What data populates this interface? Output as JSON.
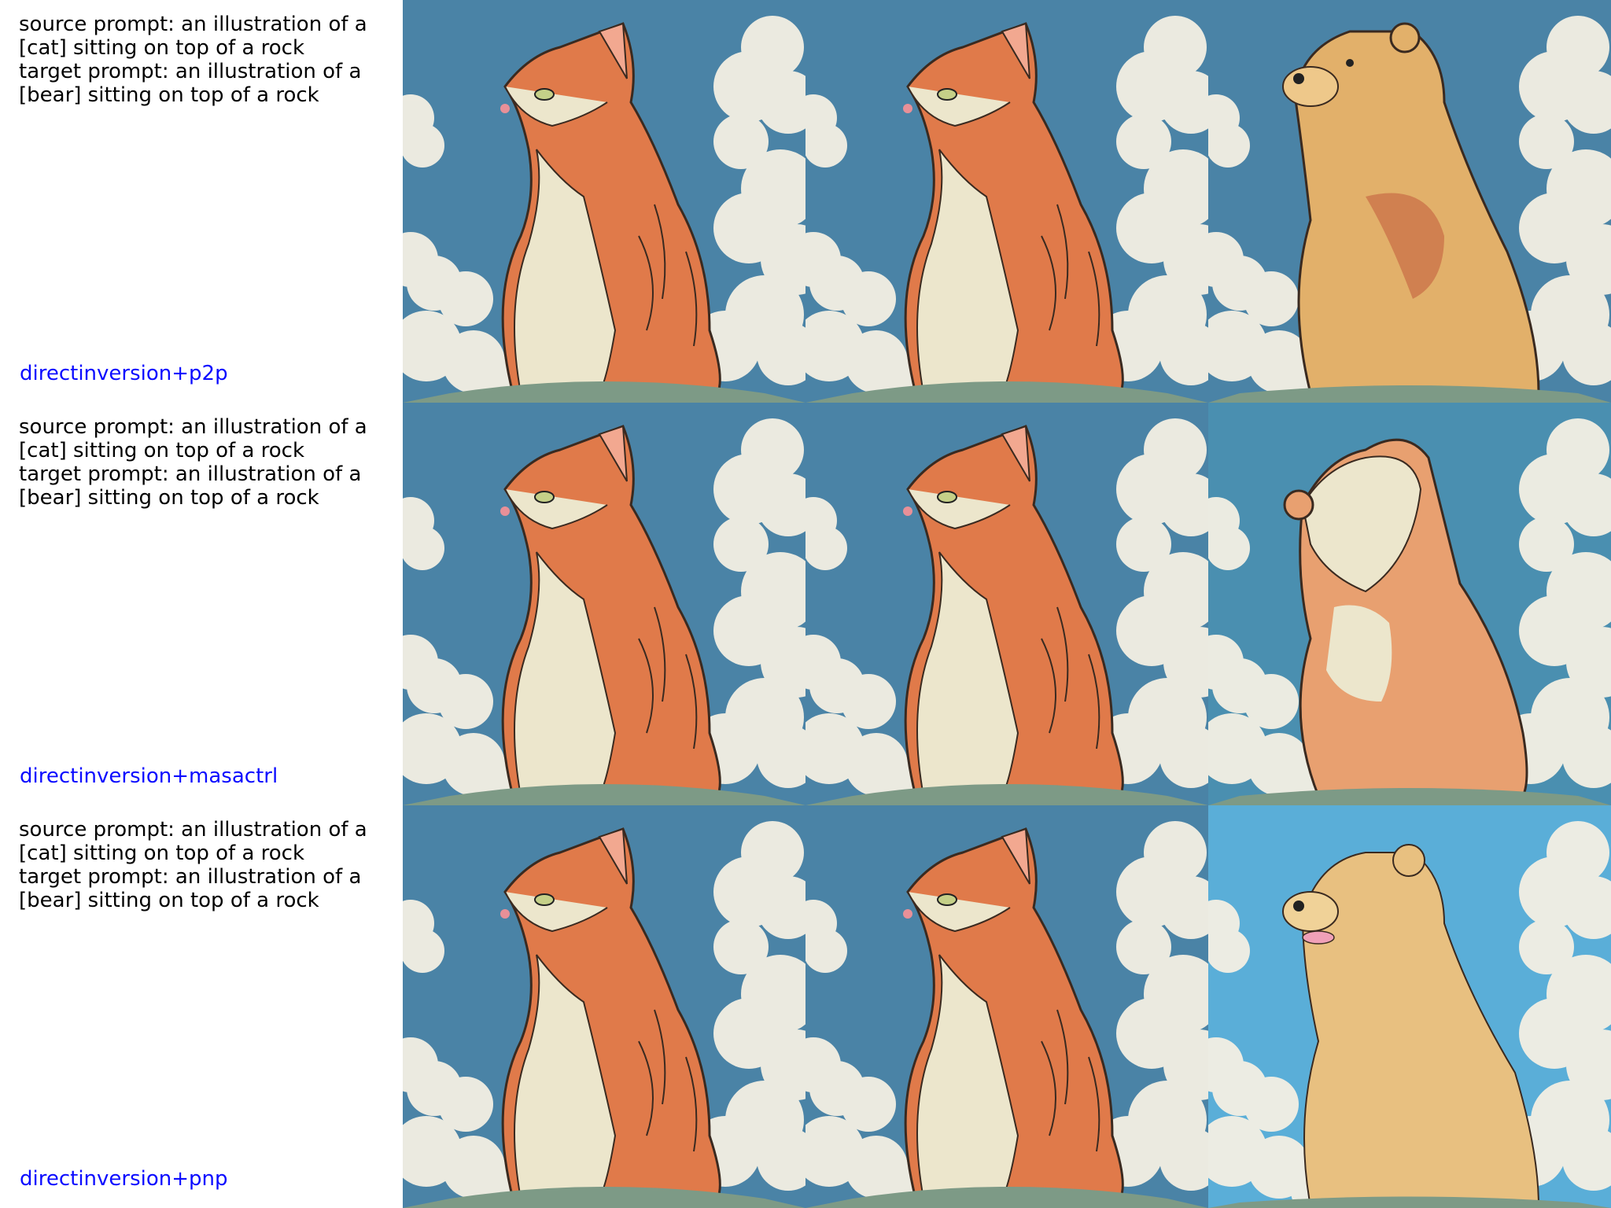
{
  "rows": [
    {
      "source_prompt": "source prompt: an illustration of a [cat] sitting on top of a rock",
      "target_prompt": "target prompt: an illustration of a [bear] sitting on top of a rock",
      "method": "directinversion+p2p",
      "panels": [
        "source-cat-image",
        "reconstructed-cat-image",
        "edited-bear-image"
      ]
    },
    {
      "source_prompt": "source prompt: an illustration of a [cat] sitting on top of a rock",
      "target_prompt": "target prompt: an illustration of a [bear] sitting on top of a rock",
      "method": "directinversion+masactrl",
      "panels": [
        "source-cat-image",
        "reconstructed-cat-image",
        "edited-bear-image"
      ]
    },
    {
      "source_prompt": "source prompt: an illustration of a [cat] sitting on top of a rock",
      "target_prompt": "target prompt: an illustration of a [bear] sitting on top of a rock",
      "method": "directinversion+pnp",
      "panels": [
        "source-cat-image",
        "reconstructed-cat-image",
        "edited-bear-image"
      ]
    }
  ],
  "colors": {
    "sky": "#4a83a6",
    "sky_light": "#5aaed8",
    "cloud": "#f4f0e4",
    "cat_orange": "#e07a4a",
    "cat_cream": "#ece6cc",
    "bear_tan": "#e2b06a",
    "rock": "#7d9a86",
    "method_text": "#0b0bff"
  }
}
